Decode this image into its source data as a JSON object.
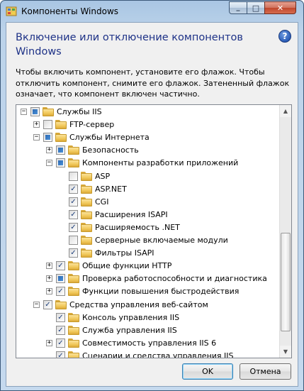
{
  "window": {
    "title": "Компоненты Windows",
    "minimize_glyph": "_",
    "maximize_glyph": "□",
    "close_glyph": "✕"
  },
  "dialog": {
    "heading": "Включение или отключение компонентов Windows",
    "help_glyph": "?",
    "description": "Чтобы включить компонент, установите его флажок. Чтобы отключить компонент, снимите его флажок. Затененный флажок означает, что компонент включен частично."
  },
  "tree": {
    "items": [
      {
        "label": "Службы IIS",
        "level": 0,
        "expander": "−",
        "state": "partial"
      },
      {
        "label": "FTP-сервер",
        "level": 1,
        "expander": "+",
        "state": "unchecked"
      },
      {
        "label": "Службы Интернета",
        "level": 1,
        "expander": "−",
        "state": "partial"
      },
      {
        "label": "Безопасность",
        "level": 2,
        "expander": "+",
        "state": "partial"
      },
      {
        "label": "Компоненты разработки приложений",
        "level": 2,
        "expander": "−",
        "state": "partial"
      },
      {
        "label": "ASP",
        "level": 3,
        "expander": "",
        "state": "unchecked"
      },
      {
        "label": "ASP.NET",
        "level": 3,
        "expander": "",
        "state": "checked"
      },
      {
        "label": "CGI",
        "level": 3,
        "expander": "",
        "state": "checked"
      },
      {
        "label": "Расширения ISAPI",
        "level": 3,
        "expander": "",
        "state": "checked"
      },
      {
        "label": "Расширяемость .NET",
        "level": 3,
        "expander": "",
        "state": "checked"
      },
      {
        "label": "Серверные включаемые модули",
        "level": 3,
        "expander": "",
        "state": "unchecked"
      },
      {
        "label": "Фильтры ISAPI",
        "level": 3,
        "expander": "",
        "state": "checked"
      },
      {
        "label": "Общие функции HTTP",
        "level": 2,
        "expander": "+",
        "state": "checked"
      },
      {
        "label": "Проверка работоспособности и диагностика",
        "level": 2,
        "expander": "+",
        "state": "partial"
      },
      {
        "label": "Функции повышения быстродействия",
        "level": 2,
        "expander": "+",
        "state": "checked"
      },
      {
        "label": "Средства управления веб-сайтом",
        "level": 1,
        "expander": "−",
        "state": "checked"
      },
      {
        "label": "Консоль управления IIS",
        "level": 2,
        "expander": "",
        "state": "checked"
      },
      {
        "label": "Служба управления IIS",
        "level": 2,
        "expander": "",
        "state": "checked"
      },
      {
        "label": "Совместимость управления IIS 6",
        "level": 2,
        "expander": "+",
        "state": "checked"
      },
      {
        "label": "Сценарии и средства управления IIS",
        "level": 2,
        "expander": "",
        "state": "checked"
      }
    ],
    "check_glyph": "✓"
  },
  "buttons": {
    "ok": "OK",
    "cancel": "Отмена"
  },
  "scrollbar": {
    "up_glyph": "▲",
    "down_glyph": "▼"
  }
}
